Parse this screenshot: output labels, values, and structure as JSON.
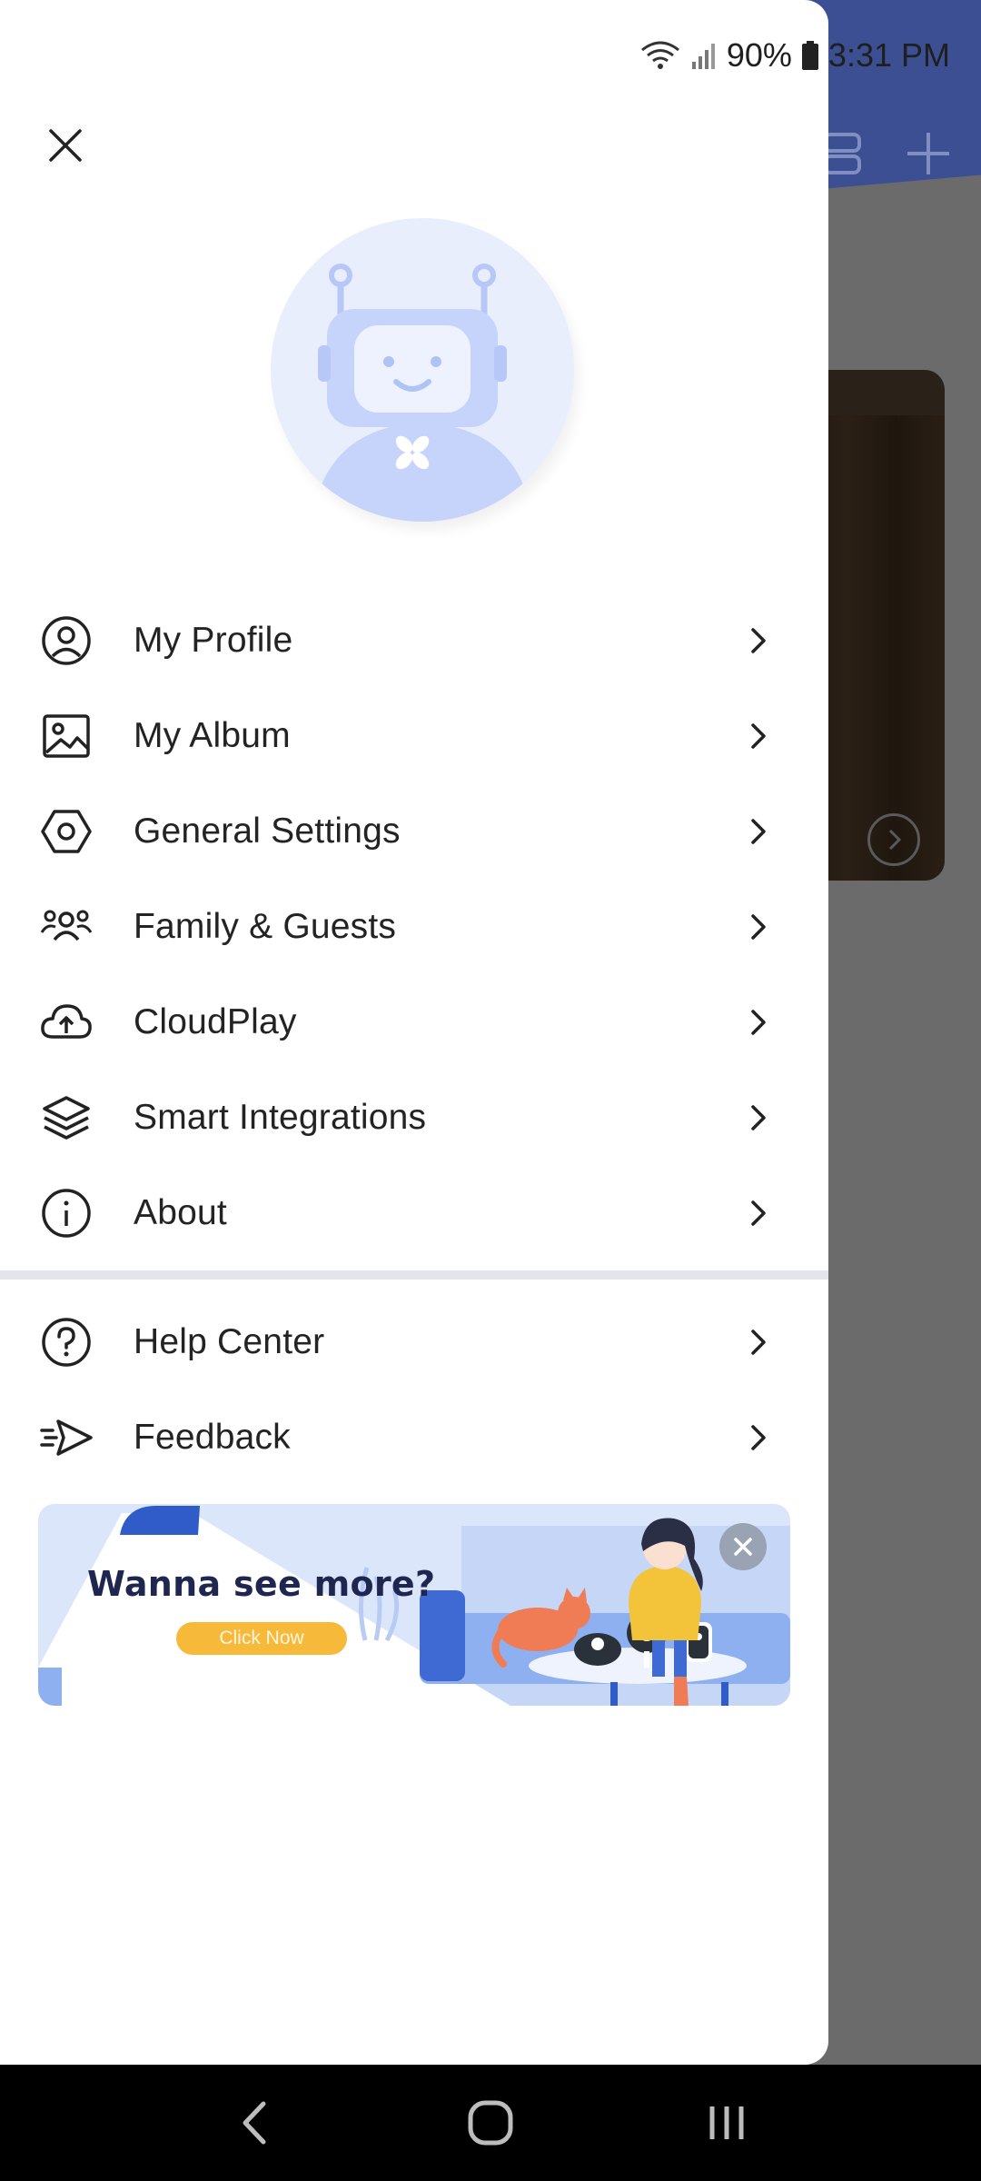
{
  "status_bar": {
    "battery": "90%",
    "time": "3:31 PM"
  },
  "drawer": {
    "close_icon": "close-icon",
    "avatar_icon": "robot-avatar",
    "menu_primary": [
      {
        "label": "My Profile",
        "icon": "user-circle-icon"
      },
      {
        "label": "My Album",
        "icon": "image-icon"
      },
      {
        "label": "General Settings",
        "icon": "hexagon-settings-icon"
      },
      {
        "label": "Family & Guests",
        "icon": "group-icon"
      },
      {
        "label": "CloudPlay",
        "icon": "cloud-upload-icon"
      },
      {
        "label": "Smart Integrations",
        "icon": "layers-icon"
      },
      {
        "label": "About",
        "icon": "info-icon"
      }
    ],
    "menu_secondary": [
      {
        "label": "Help Center",
        "icon": "help-icon"
      },
      {
        "label": "Feedback",
        "icon": "send-icon"
      }
    ],
    "banner": {
      "title": "Wanna see more?",
      "button": "Click Now"
    }
  },
  "colors": {
    "accent_blue": "#3b4f92",
    "banner_yellow": "#f7b93a",
    "avatar_bg": "#e8eefc"
  }
}
